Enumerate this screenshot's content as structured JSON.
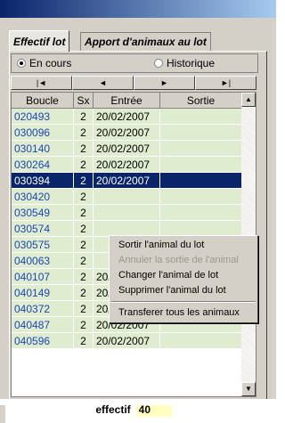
{
  "tabs": [
    "Effectif lot",
    "Apport d'animaux au lot"
  ],
  "filter": {
    "options": [
      "En cours",
      "Historique"
    ],
    "selected": "En cours"
  },
  "nav": {
    "first": "|◄",
    "prev": "◄",
    "next": "►",
    "last": "►|"
  },
  "table": {
    "columns": [
      "Boucle",
      "Sx",
      "Entrée",
      "Sortie"
    ],
    "rows": [
      {
        "boucle": "020493",
        "sx": "2",
        "entree": "20/02/2007",
        "sortie": ""
      },
      {
        "boucle": "030096",
        "sx": "2",
        "entree": "20/02/2007",
        "sortie": ""
      },
      {
        "boucle": "030140",
        "sx": "2",
        "entree": "20/02/2007",
        "sortie": ""
      },
      {
        "boucle": "030264",
        "sx": "2",
        "entree": "20/02/2007",
        "sortie": ""
      },
      {
        "boucle": "030394",
        "sx": "2",
        "entree": "20/02/2007",
        "sortie": "",
        "selected": true
      },
      {
        "boucle": "030420",
        "sx": "2",
        "entree": "",
        "sortie": ""
      },
      {
        "boucle": "030549",
        "sx": "2",
        "entree": "",
        "sortie": ""
      },
      {
        "boucle": "030574",
        "sx": "2",
        "entree": "",
        "sortie": ""
      },
      {
        "boucle": "030575",
        "sx": "2",
        "entree": "",
        "sortie": ""
      },
      {
        "boucle": "040063",
        "sx": "2",
        "entree": "",
        "sortie": ""
      },
      {
        "boucle": "040107",
        "sx": "2",
        "entree": "20/02/2007",
        "sortie": ""
      },
      {
        "boucle": "040149",
        "sx": "2",
        "entree": "20/02/2007",
        "sortie": ""
      },
      {
        "boucle": "040372",
        "sx": "2",
        "entree": "20/02/2007",
        "sortie": ""
      },
      {
        "boucle": "040487",
        "sx": "2",
        "entree": "20/02/2007",
        "sortie": ""
      },
      {
        "boucle": "040596",
        "sx": "2",
        "entree": "20/02/2007",
        "sortie": ""
      }
    ]
  },
  "context_menu": {
    "items": [
      {
        "label": "Sortir l'animal du lot",
        "disabled": false
      },
      {
        "label": "Annuler la sortie de l'animal",
        "disabled": true
      },
      {
        "label": "Changer l'animal de lot",
        "disabled": false
      },
      {
        "label": "Supprimer l'animal du lot",
        "disabled": false
      },
      {
        "separator": true
      },
      {
        "label": "Transferer tous les animaux",
        "disabled": false
      }
    ]
  },
  "footer": {
    "label": "effectif",
    "value": "40"
  }
}
